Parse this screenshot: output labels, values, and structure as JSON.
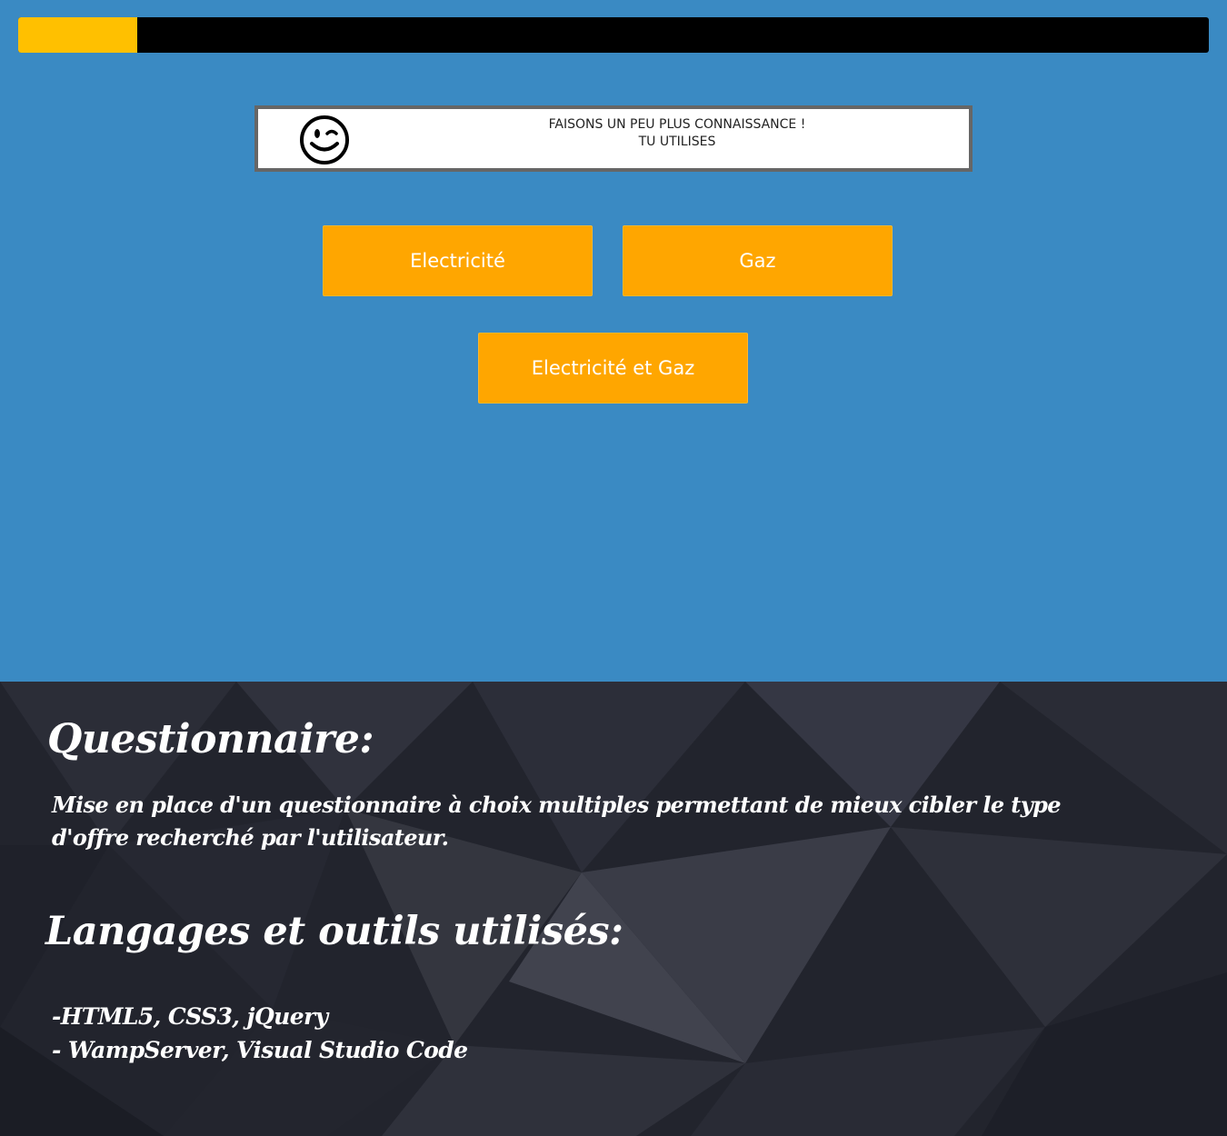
{
  "progress": {
    "value_percent": 10,
    "fill_color": "#ffc000",
    "track_color": "#000000"
  },
  "banner": {
    "icon": "smiley-wink-icon",
    "line1": "FAISONS UN PEU PLUS CONNAISSANCE !",
    "line2": "TU UTILISES"
  },
  "choices": {
    "electricite": "Electricité",
    "gaz": "Gaz",
    "electricite_gaz": "Electricité et Gaz"
  },
  "colors": {
    "background": "#3a8ac3",
    "button": "#ffa600",
    "footer": "#22242d"
  },
  "project": {
    "title": "Questionnaire:",
    "description": "Mise en place d'un questionnaire à choix multiples permettant de mieux cibler le type d'offre recherché par l'utilisateur.",
    "tools_title": "Langages et outils utilisés:",
    "tools_line1": "-HTML5, CSS3, jQuery",
    "tools_line2": "- WampServer, Visual Studio Code"
  }
}
